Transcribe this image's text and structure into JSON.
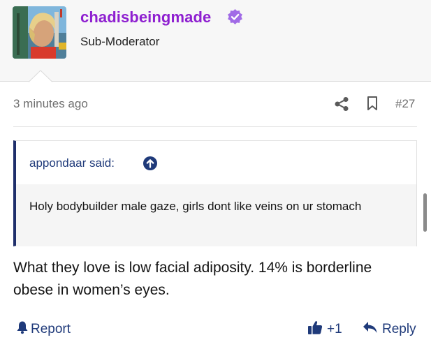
{
  "user": {
    "username": "chadisbeingmade",
    "title": "Sub-Moderator",
    "avatar_icon": "avatar-photo",
    "verified_icon": "verified-check-icon",
    "username_color": "#8e1fd0"
  },
  "post": {
    "timestamp": "3 minutes ago",
    "post_number": "#27",
    "share_icon": "share-icon",
    "bookmark_icon": "bookmark-icon",
    "quote": {
      "author_said": "appondaar said:",
      "jump_icon": "arrow-up-circle-icon",
      "text": "Holy bodybuilder male gaze, girls dont like veins on ur stomach"
    },
    "body": "What they love is low facial adiposity. 14% is borderline obese in women’s eyes."
  },
  "actions": {
    "report_label": "Report",
    "like_count": "+1",
    "reply_label": "Reply"
  },
  "colors": {
    "accent": "#1f3a7a",
    "quote_bar": "#1f2f6b"
  }
}
